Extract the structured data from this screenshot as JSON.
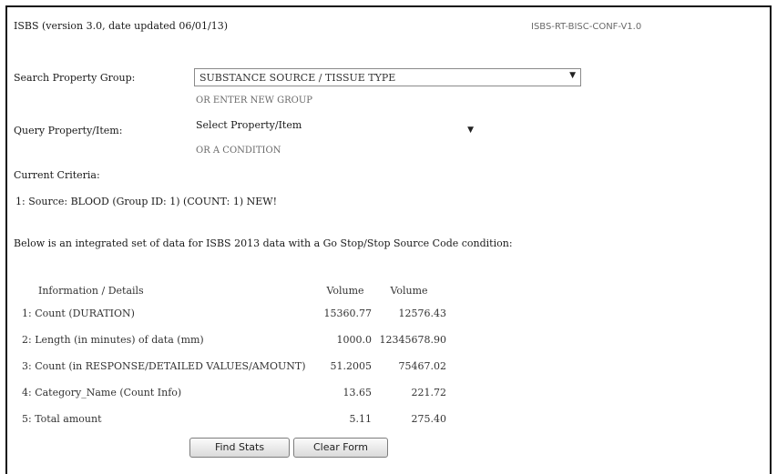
{
  "header": {
    "title": "ISBS (version 3.0, date updated 06/01/13)",
    "link": "ISBS-RT-BISC-CONF-V1.0"
  },
  "form": {
    "search_label": "Search Property Group:",
    "search_value": "SUBSTANCE SOURCE / TISSUE TYPE",
    "search_hint": "OR ENTER NEW GROUP",
    "query_label": "Query Property/Item:",
    "query_value": "Select Property/Item",
    "query_hint": "OR A CONDITION"
  },
  "current": {
    "label": "Current Criteria:",
    "value": "1: Source: BLOOD  (Group ID: 1)  (COUNT: 1)   NEW!"
  },
  "notice": "Below is an integrated set of data for ISBS 2013 data with a Go Stop/Stop Source Code condition:",
  "table": {
    "headers": [
      "Information / Details",
      "Volume",
      "Volume"
    ],
    "rows": [
      [
        "1: Count (DURATION)",
        "15360.77",
        "12576.43"
      ],
      [
        "2: Length (in minutes) of data (mm)",
        "1000.0",
        "12345678.90"
      ],
      [
        "3: Count (in RESPONSE/DETAILED VALUES/AMOUNT)",
        "51.2005",
        "75467.02"
      ],
      [
        "4: Category_Name (Count Info)",
        "13.65",
        "221.72"
      ],
      [
        "5: Total amount",
        "5.11",
        "275.40"
      ]
    ]
  },
  "buttons": {
    "primary": "Find Stats",
    "secondary": "Clear Form"
  }
}
